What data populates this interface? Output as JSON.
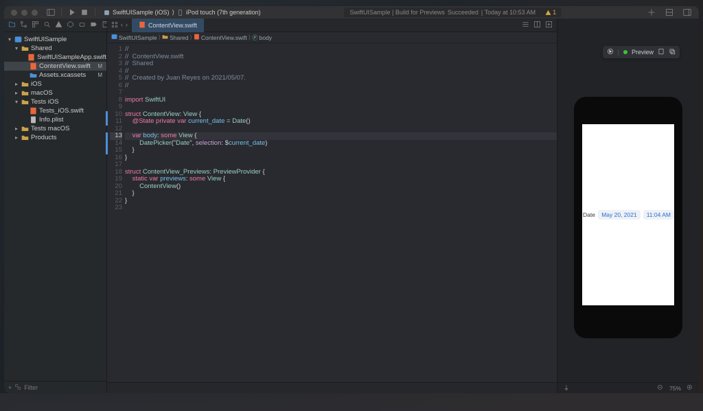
{
  "titlebar": {
    "scheme_app": "SwiftUISample (iOS)",
    "scheme_sep": "⟩",
    "scheme_device": "iPod touch (7th generation)",
    "status_left": "SwiftUISample | Build for Previews",
    "status_result": "Succeeded",
    "status_time": "| Today at 10:53 AM",
    "warn_count": "1"
  },
  "navigator": {
    "root": "SwiftUISample",
    "shared": "Shared",
    "app_file": "SwiftUISampleApp.swift",
    "content_file": "ContentView.swift",
    "assets": "Assets.xcassets",
    "ios": "iOS",
    "macos": "macOS",
    "tests_ios": "Tests iOS",
    "tests_ios_file": "Tests_iOS.swift",
    "info_plist": "Info.plist",
    "tests_macos": "Tests macOS",
    "products": "Products",
    "mod_marker": "M",
    "filter_placeholder": "Filter"
  },
  "tabs": {
    "open": "ContentView.swift"
  },
  "breadcrumb": {
    "p0": "SwiftUISample",
    "p1": "Shared",
    "p2": "ContentView.swift",
    "p3": "body"
  },
  "code": {
    "lines": [
      "//",
      "//  ContentView.swift",
      "//  Shared",
      "//",
      "//  Created by Juan Reyes on 2021/05/07.",
      "//",
      "",
      "import SwiftUI",
      "",
      "struct ContentView: View {",
      "    @State private var current_date = Date()",
      "",
      "    var body: some View {",
      "        DatePicker(\"Date\", selection: $current_date)",
      "    }",
      "}",
      "",
      "struct ContentView_Previews: PreviewProvider {",
      "    static var previews: some View {",
      "        ContentView()",
      "    }",
      "}",
      ""
    ]
  },
  "preview": {
    "label": "Preview",
    "picker_label": "Date",
    "date_value": "May 20, 2021",
    "time_value": "11:04 AM"
  },
  "footer": {
    "zoom": "75%"
  }
}
